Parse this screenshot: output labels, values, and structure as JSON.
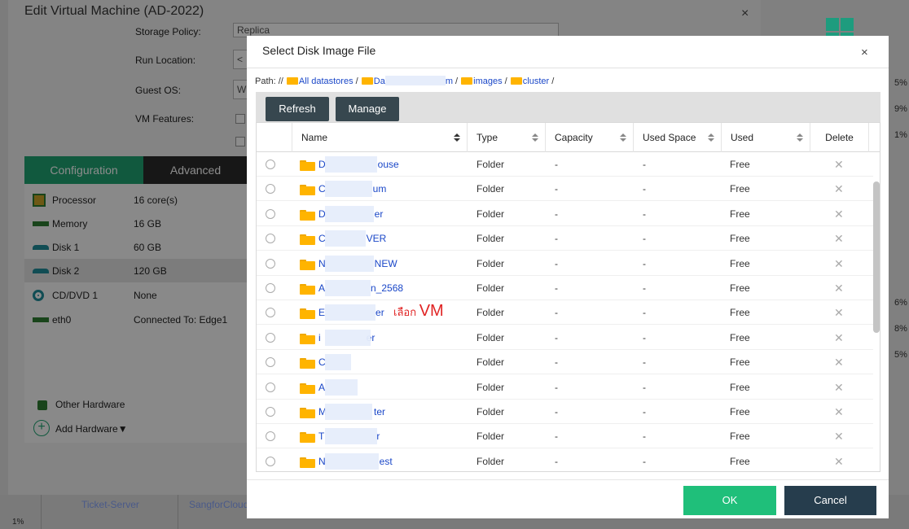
{
  "background": {
    "percents": [
      "5%",
      "9%",
      "1%",
      "6%",
      "8%",
      "5%"
    ],
    "bottom_left_pct": "1%",
    "bottom_cells": [
      "Ticket-Server",
      "SangforCloud"
    ]
  },
  "edit_dialog": {
    "title": "Edit Virtual Machine (AD-2022)",
    "close_icon": "×",
    "form": {
      "storage_policy_label": "Storage Policy:",
      "storage_policy_value": "Replica",
      "run_location_label": "Run Location:",
      "run_location_value": "<",
      "guest_os_label": "Guest OS:",
      "guest_os_value": "W",
      "vm_features_label": "VM Features:"
    },
    "tabs": [
      "Configuration",
      "Advanced"
    ],
    "hardware": [
      {
        "name": "Processor",
        "value": "16 core(s)",
        "icon": "processor-icon"
      },
      {
        "name": "Memory",
        "value": "16 GB",
        "icon": "memory-icon"
      },
      {
        "name": "Disk 1",
        "value": "60 GB",
        "icon": "disk-icon"
      },
      {
        "name": "Disk 2",
        "value": "120 GB",
        "icon": "disk-icon"
      },
      {
        "name": "CD/DVD 1",
        "value": "None",
        "icon": "cdrom-icon"
      },
      {
        "name": "eth0",
        "value": "Connected To: Edge1",
        "icon": "network-icon"
      }
    ],
    "other_hardware": "Other Hardware",
    "add_hardware": "Add Hardware▼"
  },
  "select_dialog": {
    "title": "Select Disk Image File",
    "close_icon": "×",
    "path": {
      "prefix": "Path: //",
      "segments": [
        "All datastores",
        "Da",
        "m",
        "images",
        "cluster"
      ],
      "sep": " / "
    },
    "toolbar": {
      "refresh": "Refresh",
      "manage": "Manage"
    },
    "columns": [
      "Name",
      "Type",
      "Capacity",
      "Used Space",
      "Used",
      "Delete"
    ],
    "rows": [
      {
        "pre": "D",
        "post": "ouse",
        "type": "Folder",
        "capacity": "-",
        "used_space": "-",
        "used": "Free"
      },
      {
        "pre": "C",
        "post": "um",
        "type": "Folder",
        "capacity": "-",
        "used_space": "-",
        "used": "Free"
      },
      {
        "pre": "D",
        "post": "er",
        "type": "Folder",
        "capacity": "-",
        "used_space": "-",
        "used": "Free"
      },
      {
        "pre": "C",
        "post": "VER",
        "type": "Folder",
        "capacity": "-",
        "used_space": "-",
        "used": "Free"
      },
      {
        "pre": "N",
        "post": "NEW",
        "type": "Folder",
        "capacity": "-",
        "used_space": "-",
        "used": "Free"
      },
      {
        "pre": "A",
        "post": "n_2568",
        "type": "Folder",
        "capacity": "-",
        "used_space": "-",
        "used": "Free"
      },
      {
        "pre": "E",
        "post": "er",
        "type": "Folder",
        "capacity": "-",
        "used_space": "-",
        "used": "Free"
      },
      {
        "pre": "i",
        "post": "er",
        "type": "Folder",
        "capacity": "-",
        "used_space": "-",
        "used": "Free"
      },
      {
        "pre": "C",
        "post": "",
        "type": "Folder",
        "capacity": "-",
        "used_space": "-",
        "used": "Free"
      },
      {
        "pre": "A",
        "post": "",
        "type": "Folder",
        "capacity": "-",
        "used_space": "-",
        "used": "Free"
      },
      {
        "pre": "M",
        "post": "ter",
        "type": "Folder",
        "capacity": "-",
        "used_space": "-",
        "used": "Free"
      },
      {
        "pre": "T",
        "post": "r",
        "type": "Folder",
        "capacity": "-",
        "used_space": "-",
        "used": "Free"
      },
      {
        "pre": "N",
        "post": "est",
        "type": "Folder",
        "capacity": "-",
        "used_space": "-",
        "used": "Free"
      }
    ],
    "delete_icon": "✕",
    "annotation": {
      "thai": "เลือก",
      "vm": "VM"
    },
    "ok": "OK",
    "cancel": "Cancel"
  }
}
